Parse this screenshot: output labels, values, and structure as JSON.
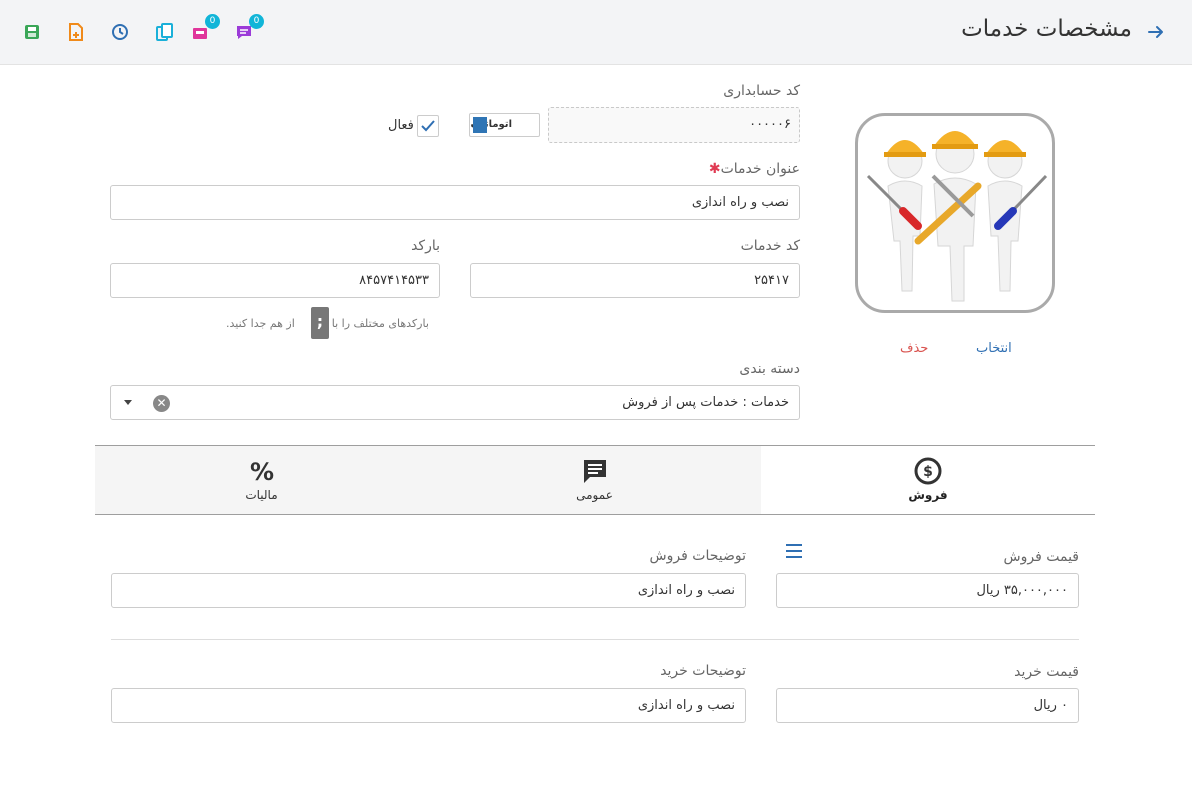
{
  "header": {
    "title": "مشخصات خدمات",
    "tools": [
      {
        "icon": "save-icon",
        "color": "#3aa657"
      },
      {
        "icon": "add-file-icon",
        "color": "#f08a1a"
      },
      {
        "icon": "history-icon",
        "color": "#2f6fb3"
      },
      {
        "icon": "copy-icon",
        "color": "#1ab0d9"
      },
      {
        "icon": "inbox-icon",
        "color": "#e0359b",
        "badge": "0"
      },
      {
        "icon": "message-icon",
        "color": "#9b3bd8",
        "badge": "0"
      }
    ]
  },
  "form": {
    "accounting_code_label": "کد حسابداری",
    "accounting_code_value": "۰۰۰۰۰۶",
    "auto_button": "اتوماتیک",
    "active_label": "فعال",
    "active_checked": true,
    "service_title_label": "عنوان خدمات",
    "required_mark": "✱",
    "service_title_value": "نصب و راه اندازی",
    "service_code_label": "کد خدمات",
    "service_code_value": "۲۵۴۱۷",
    "barcode_label": "بارکد",
    "barcode_value": "۸۴۵۷۴۱۴۵۳۳",
    "barcode_hint_before": "بارکدهای مختلف را با",
    "barcode_separator": ";",
    "barcode_hint_after": "از هم جدا کنید.",
    "category_label": "دسته بندی",
    "category_value": "خدمات : خدمات پس از فروش",
    "category_clear": "✕"
  },
  "image": {
    "select_label": "انتخاب",
    "delete_label": "حذف"
  },
  "tabs": [
    {
      "label": "فروش",
      "icon": "dollar-icon",
      "active": true
    },
    {
      "label": "عمومی",
      "icon": "comment-icon",
      "active": false
    },
    {
      "label": "مالیات",
      "icon": "percent-icon",
      "active": false
    }
  ],
  "sale": {
    "price_label": "قیمت فروش",
    "price_value": "۳۵,۰۰۰,۰۰۰ ریال",
    "desc_label": "توضیحات فروش",
    "desc_value": "نصب و راه اندازی"
  },
  "purchase": {
    "price_label": "قیمت خرید",
    "price_value": "۰ ریال",
    "desc_label": "توضیحات خرید",
    "desc_value": "نصب و راه اندازی"
  },
  "colors": {
    "accent_blue": "#2f6fb3",
    "danger": "#d9534f",
    "required": "#e03b53"
  }
}
